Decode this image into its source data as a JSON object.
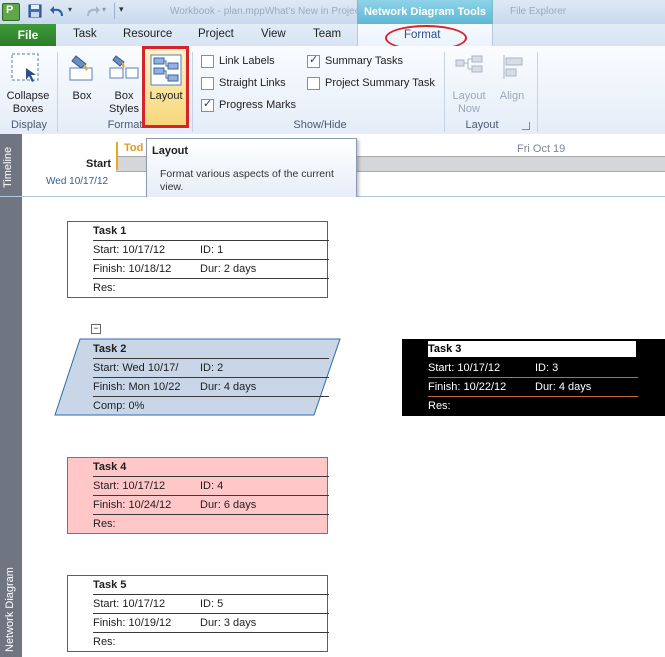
{
  "window": {
    "context_tab_title": "Network Diagram Tools",
    "ghost_titles": [
      "Workbook - plan.mpp",
      "What's New in Project",
      "File Explorer"
    ]
  },
  "tabs": {
    "file": "File",
    "items": [
      "Task",
      "Resource",
      "Project",
      "View",
      "Team"
    ],
    "format": "Format"
  },
  "ribbon": {
    "display": {
      "collapse_boxes": "Collapse Boxes",
      "group": "Display"
    },
    "format": {
      "box": "Box",
      "box_styles": "Box Styles",
      "layout": "Layout",
      "group": "Format"
    },
    "show_hide": {
      "link_labels": {
        "label": "Link Labels",
        "checked": false
      },
      "straight_links": {
        "label": "Straight Links",
        "checked": false
      },
      "progress_marks": {
        "label": "Progress Marks",
        "checked": true
      },
      "summary_tasks": {
        "label": "Summary Tasks",
        "checked": true
      },
      "project_summary_task": {
        "label": "Project Summary Task",
        "checked": false
      },
      "group": "Show/Hide"
    },
    "layout_group": {
      "layout_now": "Layout Now",
      "align": "Align",
      "group": "Layout"
    }
  },
  "timeline": {
    "label": "Timeline",
    "start_label": "Start",
    "start_date": "Wed 10/17/12",
    "today": "Tod",
    "fri": "Fri Oct 19"
  },
  "tooltip": {
    "title": "Layout",
    "body": "Format various aspects of the current view."
  },
  "network_diagram": {
    "label": "Network Diagram",
    "collapse_glyph": "−",
    "tasks": [
      {
        "name": "Task 1",
        "start": "Start:  10/17/12",
        "id": "ID:   1",
        "finish": "Finish: 10/18/12",
        "dur": "Dur: 2 days",
        "extra": "Res:"
      },
      {
        "name": "Task 2",
        "start": "Start:  Wed 10/17/",
        "id": "ID:   2",
        "finish": "Finish: Mon 10/22",
        "dur": "Dur: 4 days",
        "extra": "Comp: 0%"
      },
      {
        "name": "Task 3",
        "start": "Start:  10/17/12",
        "id": "ID:   3",
        "finish": "Finish: 10/22/12",
        "dur": "Dur: 4 days",
        "extra": "Res:"
      },
      {
        "name": "Task 4",
        "start": "Start:  10/17/12",
        "id": "ID:   4",
        "finish": "Finish: 10/24/12",
        "dur": "Dur: 6 days",
        "extra": "Res:"
      },
      {
        "name": "Task 5",
        "start": "Start:  10/17/12",
        "id": "ID:   5",
        "finish": "Finish: 10/19/12",
        "dur": "Dur: 3 days",
        "extra": "Res:"
      }
    ]
  },
  "colors": {
    "file_tab": "#2d7d2a",
    "context_tab": "#5db7d5",
    "annotation_red": "#d9232b",
    "summary_node_fill": "#c9d6e8",
    "critical_node_fill": "#ffc7c7",
    "selected_node_fill": "#000000",
    "node_border": "#2f6aa8"
  }
}
